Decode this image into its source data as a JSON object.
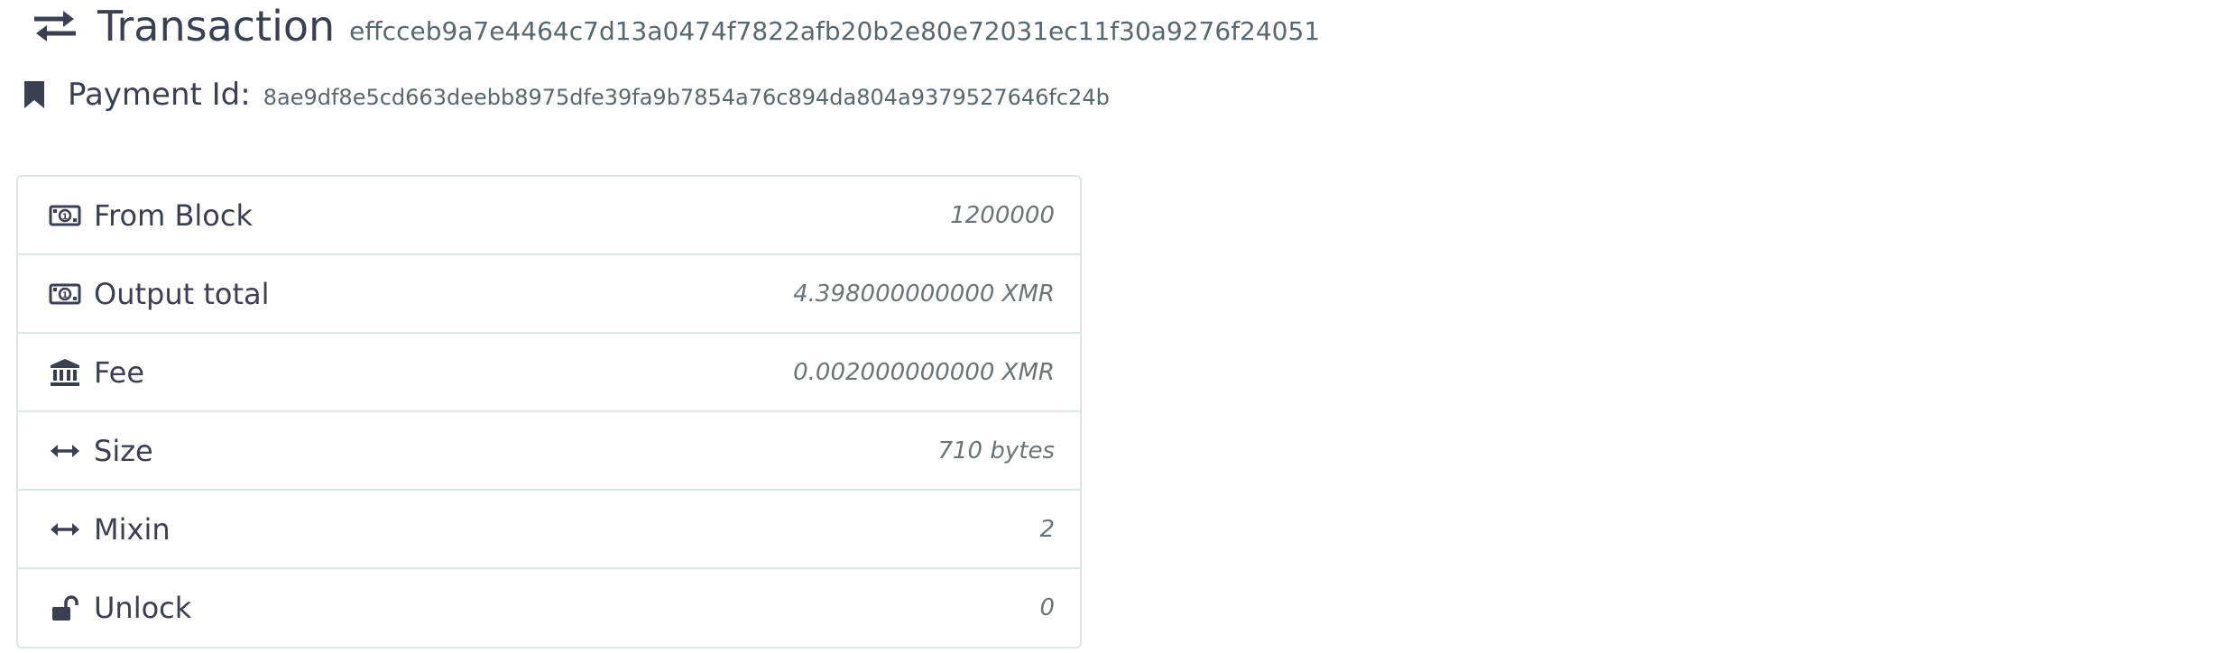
{
  "header": {
    "icon": "exchange-icon",
    "title": "Transaction",
    "hash": "effcceb9a7e4464c7d13a0474f7822afb20b2e80e72031ec11f30a9276f24051"
  },
  "payment": {
    "icon": "bookmark-icon",
    "label": "Payment Id:",
    "value": "8ae9df8e5cd663deebb8975dfe39fa9b7854a76c894da804a9379527646fc24b"
  },
  "details": [
    {
      "icon": "money-bill-icon",
      "label": "From Block",
      "value": "1200000"
    },
    {
      "icon": "money-bill-icon",
      "label": "Output total",
      "value": "4.398000000000 XMR"
    },
    {
      "icon": "bank-icon",
      "label": "Fee",
      "value": "0.002000000000 XMR"
    },
    {
      "icon": "arrows-horizontal-icon",
      "label": "Size",
      "value": "710 bytes"
    },
    {
      "icon": "arrows-horizontal-icon",
      "label": "Mixin",
      "value": "2"
    },
    {
      "icon": "unlock-icon",
      "label": "Unlock",
      "value": "0"
    }
  ],
  "colors": {
    "text": "#3a3f51",
    "muted": "#58666e",
    "border": "#dee5e7"
  }
}
